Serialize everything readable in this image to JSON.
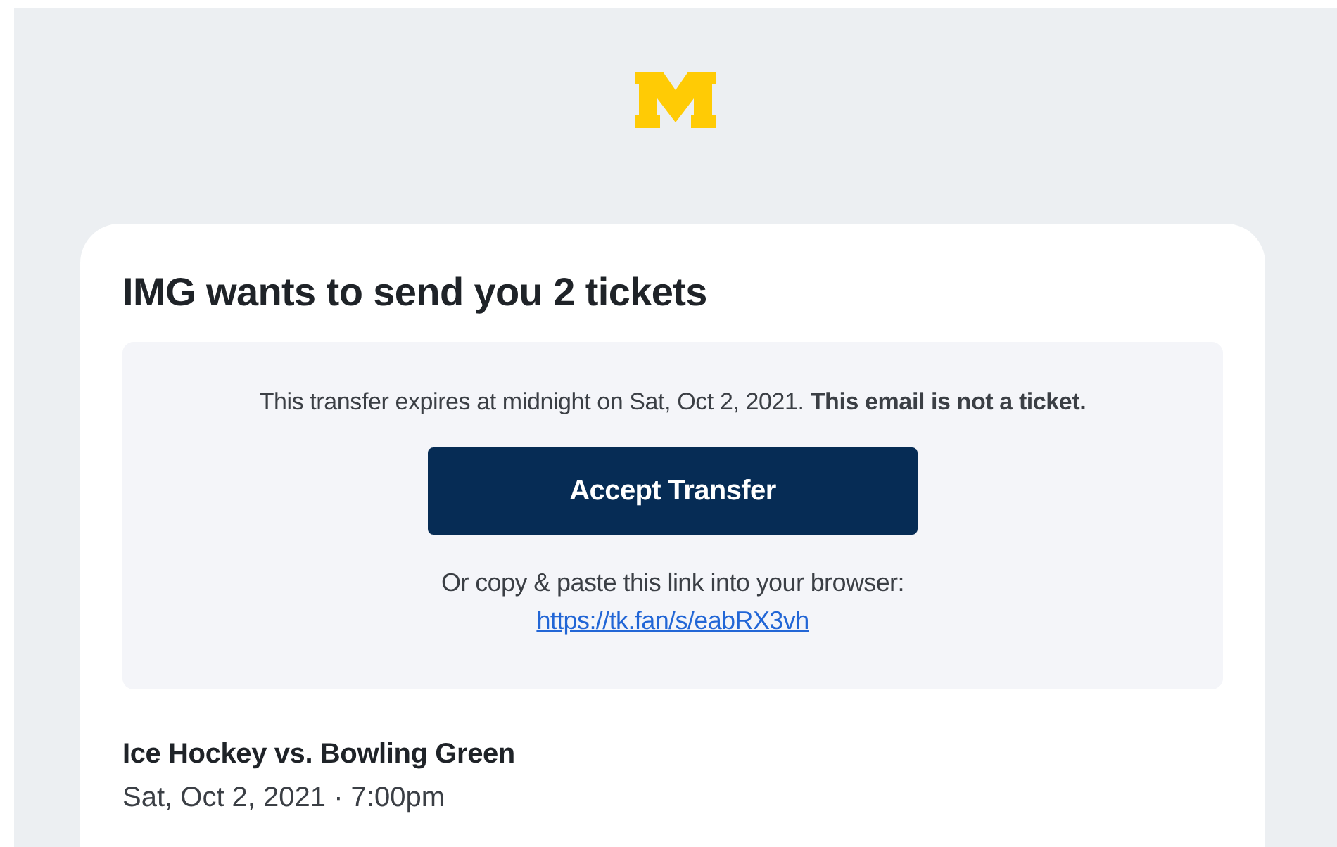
{
  "card": {
    "title": "IMG wants to send you 2 tickets",
    "notice": "This transfer expires at midnight on Sat, Oct 2, 2021. **This email is not a ticket.**",
    "button": "Accept Transfer",
    "copy_hint": "Or copy & paste this link into your browser:",
    "link": "https://tk.fan/s/eabRX3vh",
    "event": {
      "name": "Ice Hockey vs. Bowling Green",
      "date": "Sat, Oct 2, 2021 · 7:00pm"
    }
  }
}
